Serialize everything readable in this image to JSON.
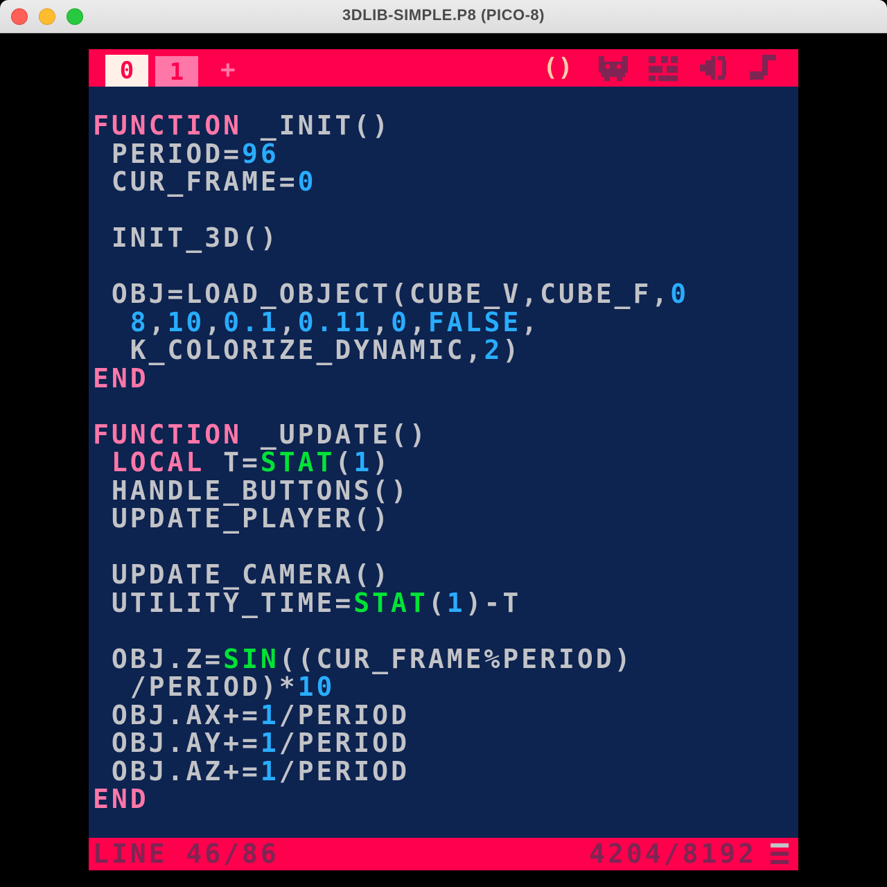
{
  "window": {
    "title": "3DLIB-SIMPLE.P8 (PICO-8)"
  },
  "tabs": [
    {
      "label": "0",
      "active": true
    },
    {
      "label": "1",
      "active": false
    }
  ],
  "add_tab_label": "+",
  "editor_icons": [
    {
      "name": "code-icon",
      "glyph": "()",
      "active": true
    },
    {
      "name": "sprite-icon",
      "active": false
    },
    {
      "name": "map-icon",
      "active": false
    },
    {
      "name": "sfx-icon",
      "active": false
    },
    {
      "name": "music-icon",
      "active": false
    }
  ],
  "code_lines": [
    [
      {
        "t": "FUNCTION",
        "c": "kw"
      },
      {
        "t": " _INIT()",
        "c": "id"
      }
    ],
    [
      {
        "t": " PERIOD=",
        "c": "id"
      },
      {
        "t": "96",
        "c": "num"
      }
    ],
    [
      {
        "t": " CUR_FRAME=",
        "c": "id"
      },
      {
        "t": "0",
        "c": "num"
      }
    ],
    [],
    [
      {
        "t": " INIT_3D()",
        "c": "id"
      }
    ],
    [],
    [
      {
        "t": " OBJ=LOAD_OBJECT(CUBE_V,CUBE_F,",
        "c": "id"
      },
      {
        "t": "0",
        "c": "num"
      }
    ],
    [
      {
        "t": "  ",
        "c": "id"
      },
      {
        "t": "8",
        "c": "num"
      },
      {
        "t": ",",
        "c": "id"
      },
      {
        "t": "10",
        "c": "num"
      },
      {
        "t": ",",
        "c": "id"
      },
      {
        "t": "0.1",
        "c": "num"
      },
      {
        "t": ",",
        "c": "id"
      },
      {
        "t": "0.11",
        "c": "num"
      },
      {
        "t": ",",
        "c": "id"
      },
      {
        "t": "0",
        "c": "num"
      },
      {
        "t": ",",
        "c": "id"
      },
      {
        "t": "FALSE",
        "c": "num"
      },
      {
        "t": ",",
        "c": "id"
      }
    ],
    [
      {
        "t": "  K_COLORIZE_DYNAMIC,",
        "c": "id"
      },
      {
        "t": "2",
        "c": "num"
      },
      {
        "t": ")",
        "c": "id"
      }
    ],
    [
      {
        "t": "END",
        "c": "kw"
      }
    ],
    [],
    [
      {
        "t": "FUNCTION",
        "c": "kw"
      },
      {
        "t": " _UPDATE()",
        "c": "id"
      }
    ],
    [
      {
        "t": " ",
        "c": "id"
      },
      {
        "t": "LOCAL",
        "c": "kw"
      },
      {
        "t": " T=",
        "c": "id"
      },
      {
        "t": "STAT",
        "c": "fn"
      },
      {
        "t": "(",
        "c": "id"
      },
      {
        "t": "1",
        "c": "num"
      },
      {
        "t": ")",
        "c": "id"
      }
    ],
    [
      {
        "t": " HANDLE_BUTTONS()",
        "c": "id"
      }
    ],
    [
      {
        "t": " UPDATE_PLAYER()",
        "c": "id"
      }
    ],
    [],
    [
      {
        "t": " UPDATE_CAMERA()",
        "c": "id"
      }
    ],
    [
      {
        "t": " UTILITY_TIME=",
        "c": "id"
      },
      {
        "t": "STAT",
        "c": "fn"
      },
      {
        "t": "(",
        "c": "id"
      },
      {
        "t": "1",
        "c": "num"
      },
      {
        "t": ")-T",
        "c": "id"
      }
    ],
    [],
    [
      {
        "t": " OBJ.Z=",
        "c": "id"
      },
      {
        "t": "SIN",
        "c": "fn"
      },
      {
        "t": "((CUR_FRAME%PERIOD)",
        "c": "id"
      }
    ],
    [
      {
        "t": "  /PERIOD)*",
        "c": "id"
      },
      {
        "t": "10",
        "c": "num"
      }
    ],
    [
      {
        "t": " OBJ.AX+=",
        "c": "id"
      },
      {
        "t": "1",
        "c": "num"
      },
      {
        "t": "/PERIOD",
        "c": "id"
      }
    ],
    [
      {
        "t": " OBJ.AY+=",
        "c": "id"
      },
      {
        "t": "1",
        "c": "num"
      },
      {
        "t": "/PERIOD",
        "c": "id"
      }
    ],
    [
      {
        "t": " OBJ.AZ+=",
        "c": "id"
      },
      {
        "t": "1",
        "c": "num"
      },
      {
        "t": "/PERIOD",
        "c": "id"
      }
    ],
    [
      {
        "t": "END",
        "c": "kw"
      }
    ]
  ],
  "status": {
    "line_text": "LINE 46/86",
    "tokens_text": "4204/8192"
  },
  "colors": {
    "bar": "#ff004d",
    "editor_bg": "#0d2350",
    "keyword": "#ff77a8",
    "number": "#29adff",
    "builtin": "#00e436",
    "identifier": "#c2c3c7",
    "status_text": "#7e2553"
  }
}
